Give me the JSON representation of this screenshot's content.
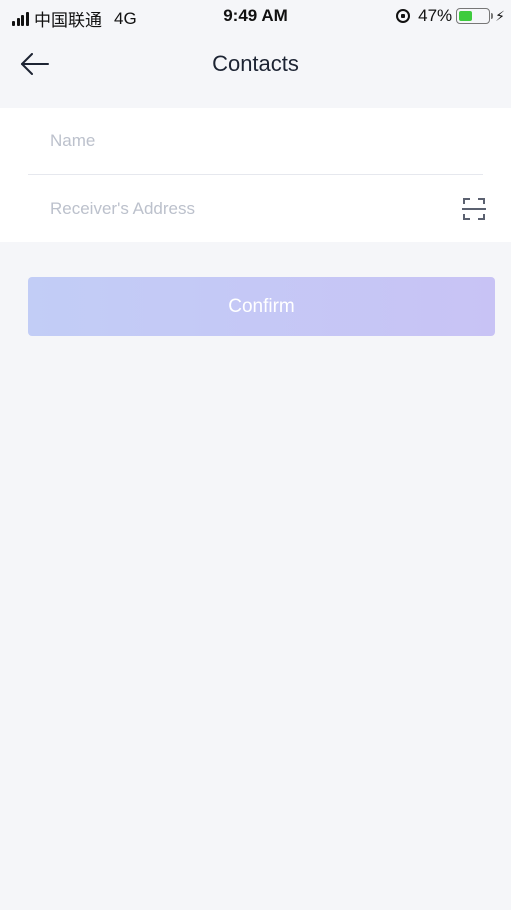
{
  "status_bar": {
    "carrier": "中国联通",
    "network": "4G",
    "time": "9:49 AM",
    "battery": "47%",
    "battery_level": 0.47,
    "battery_color": "#3ecb3e"
  },
  "nav": {
    "back_icon": "arrow-left-icon",
    "title": "Contacts"
  },
  "form": {
    "name_placeholder": "Name",
    "name_value": "",
    "address_placeholder": "Receiver's Address",
    "address_value": "",
    "scan_icon": "scan-qr-icon"
  },
  "actions": {
    "confirm_label": "Confirm",
    "confirm_gradient": [
      "#c2cdf6",
      "#c8c3f5"
    ]
  },
  "colors": {
    "background": "#f5f6f9",
    "card": "#ffffff",
    "title": "#1d2433",
    "placeholder": "#bcc1cc"
  }
}
